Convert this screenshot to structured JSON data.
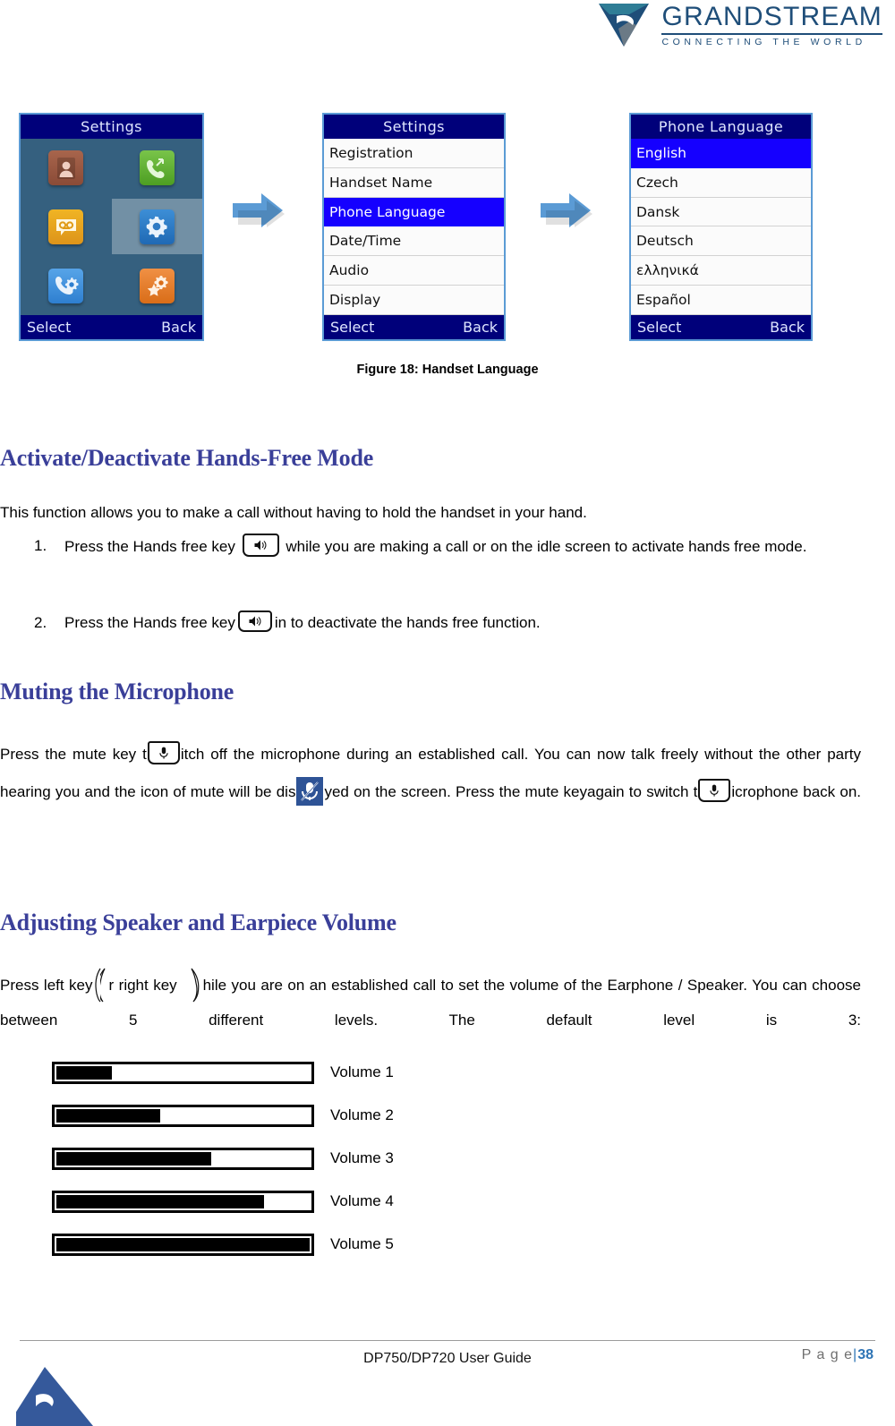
{
  "brand": {
    "name": "GRANDSTREAM",
    "tagline": "CONNECTING THE WORLD",
    "logo_color": "#1f4e79"
  },
  "figure": {
    "caption": "Figure 18: Handset Language",
    "screens": [
      {
        "type": "icon-grid",
        "title": "Settings",
        "softkey_left": "Select",
        "softkey_right": "Back",
        "icons": [
          {
            "name": "contacts-icon",
            "color": "#9c5a44"
          },
          {
            "name": "call-history-icon",
            "color": "#5aa02c"
          },
          {
            "name": "voicemail-icon",
            "color": "#e8a317"
          },
          {
            "name": "settings-gear-icon",
            "color": "#2f7ac4",
            "selected": true
          },
          {
            "name": "call-settings-icon",
            "color": "#3f8fd8"
          },
          {
            "name": "shortcut-settings-icon",
            "color": "#e07b28"
          }
        ]
      },
      {
        "type": "list",
        "title": "Settings",
        "softkey_left": "Select",
        "softkey_right": "Back",
        "items": [
          {
            "label": "Registration",
            "selected": false
          },
          {
            "label": "Handset Name",
            "selected": false
          },
          {
            "label": "Phone Language",
            "selected": true
          },
          {
            "label": "Date/Time",
            "selected": false
          },
          {
            "label": "Audio",
            "selected": false
          },
          {
            "label": "Display",
            "selected": false
          }
        ]
      },
      {
        "type": "list",
        "title": "Phone Language",
        "softkey_left": "Select",
        "softkey_right": "Back",
        "items": [
          {
            "label": "English",
            "selected": true
          },
          {
            "label": "Czech",
            "selected": false
          },
          {
            "label": "Dansk",
            "selected": false
          },
          {
            "label": "Deutsch",
            "selected": false
          },
          {
            "label": "ελληνικά",
            "selected": false
          },
          {
            "label": "Español",
            "selected": false
          }
        ]
      }
    ]
  },
  "sections": {
    "hands_free": {
      "heading": "Activate/Deactivate Hands-Free Mode",
      "intro": "This function allows you to make a call without having to hold the handset in your hand.",
      "step1_num": "1.",
      "step1_a": "Press the Hands free key",
      "step1_b": "while you are making a call or on the idle screen to activate hands free mode.",
      "step2_num": "2.",
      "step2_a": "Press the Hands free key",
      "step2_b": "in to deactivate the hands free function."
    },
    "mute": {
      "heading": "Muting the Microphone",
      "p1_a": "Press the mute key t",
      "p1_b": "itch off the microphone during an established call. You can now talk freely without the other party hearing you and the icon of mute will be dis",
      "p1_c": "yed on the screen. Press the mute keyagain to switch t",
      "p1_d": "icrophone back on."
    },
    "volume": {
      "heading": "Adjusting Speaker and Earpiece Volume",
      "p1_a": "Press left key",
      "p1_b": "r right key",
      "p1_c": "hile you are on an established call to set the volume of the Earphone / Speaker. You can choose between 5 different levels. The default level is 3:",
      "levels": [
        {
          "label": "Volume 1",
          "fill_percent": 22
        },
        {
          "label": "Volume 2",
          "fill_percent": 41
        },
        {
          "label": "Volume 3",
          "fill_percent": 61
        },
        {
          "label": "Volume 4",
          "fill_percent": 82
        },
        {
          "label": "Volume 5",
          "fill_percent": 100
        }
      ]
    }
  },
  "footer": {
    "document_title": "DP750/DP720 User Guide",
    "page_word": "P a g e",
    "page_sep": "|",
    "page_number": "38",
    "accent_color": "#2e74b5"
  }
}
